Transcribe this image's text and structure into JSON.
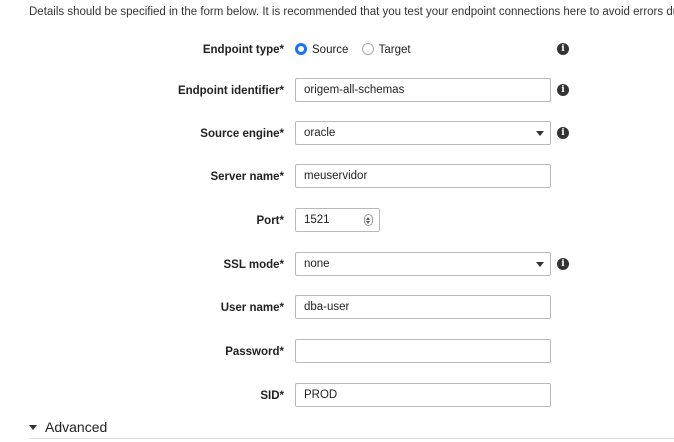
{
  "intro_text": "Details should be specified in the form below. It is recommended that you test your endpoint connections here to avoid errors during processing.",
  "endpoint_type": {
    "label": "Endpoint type*",
    "options": [
      {
        "label": "Source",
        "selected": true
      },
      {
        "label": "Target",
        "selected": false
      }
    ]
  },
  "endpoint_identifier": {
    "label": "Endpoint identifier*",
    "value": "origem-all-schemas"
  },
  "source_engine": {
    "label": "Source engine*",
    "value": "oracle"
  },
  "server_name": {
    "label": "Server name*",
    "value": "meuservidor"
  },
  "port": {
    "label": "Port*",
    "value": "1521"
  },
  "ssl_mode": {
    "label": "SSL mode*",
    "value": "none"
  },
  "user_name": {
    "label": "User name*",
    "value": "dba-user"
  },
  "password": {
    "label": "Password*",
    "value": ""
  },
  "sid": {
    "label": "SID*",
    "value": "PROD"
  },
  "advanced": {
    "label": "Advanced"
  },
  "info_glyph": "i",
  "colors": {
    "accent": "#1a73e8"
  }
}
